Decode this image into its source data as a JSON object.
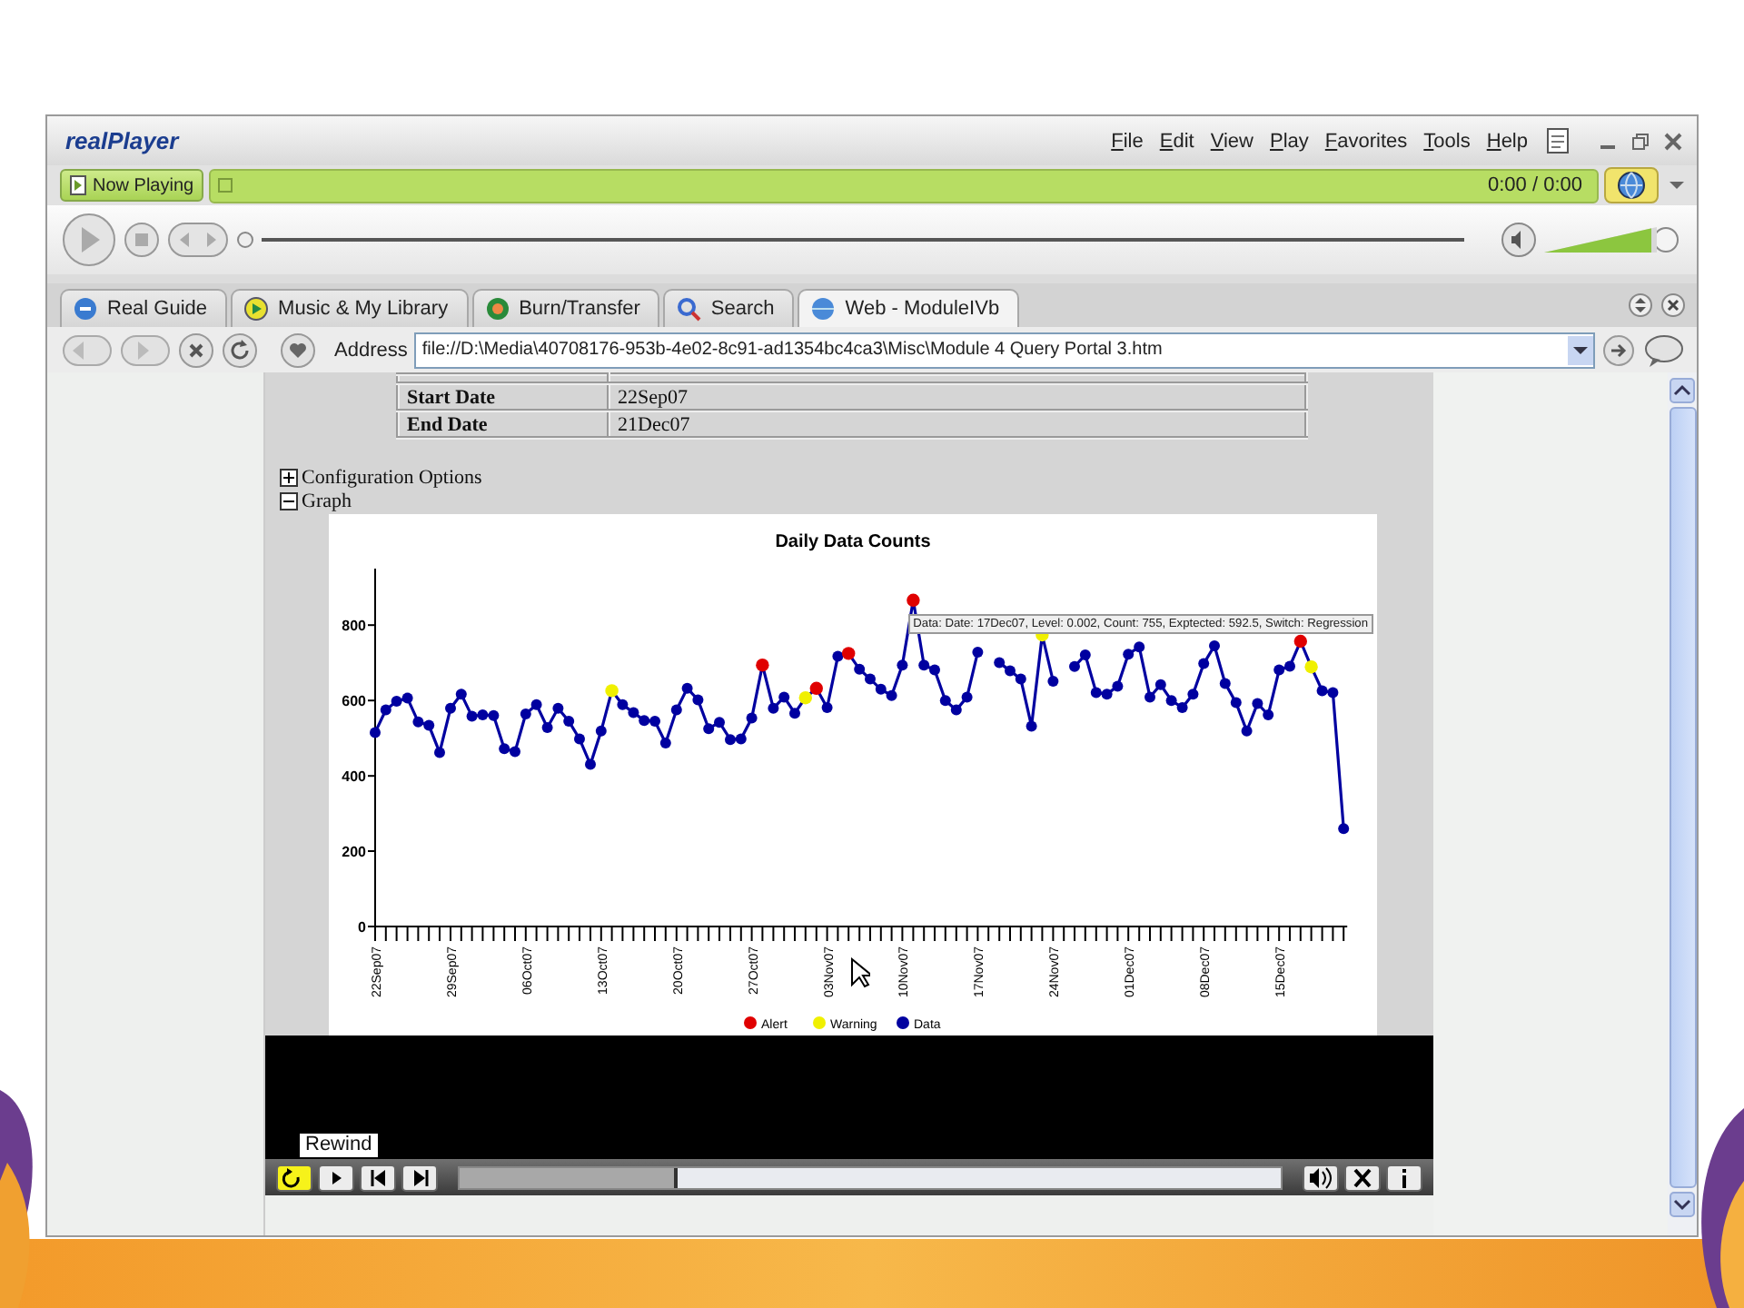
{
  "window": {
    "logo": "realPlayer",
    "menu": [
      "File",
      "Edit",
      "View",
      "Play",
      "Favorites",
      "Tools",
      "Help"
    ]
  },
  "now_playing": {
    "button": "Now Playing",
    "time": "0:00 / 0:00"
  },
  "player": {
    "volume": {
      "level": 0.95
    }
  },
  "tabs": [
    {
      "label": "Real Guide",
      "selected": false
    },
    {
      "label": "Music & My Library",
      "selected": false
    },
    {
      "label": "Burn/Transfer",
      "selected": false
    },
    {
      "label": "Search",
      "selected": false
    },
    {
      "label": "Web - ModuleIVb",
      "selected": true
    }
  ],
  "address_bar": {
    "label": "Address",
    "value": "file://D:\\Media\\40708176-953b-4e02-8c91-ad1354bc4ca3\\Misc\\Module 4 Query Portal 3.htm"
  },
  "page": {
    "table": [
      {
        "label": "Start Date",
        "value": "22Sep07"
      },
      {
        "label": "End Date",
        "value": "21Dec07"
      }
    ],
    "sections": [
      {
        "label": "Configuration Options",
        "expanded": false
      },
      {
        "label": "Graph",
        "expanded": true
      }
    ],
    "graph": {
      "tooltip": "Data: Date: 17Dec07, Level: 0.002, Count: 755, Exptected: 592.5, Switch: Regression",
      "legend": [
        {
          "kind": "alert",
          "label": "Alert",
          "color": "#e00000"
        },
        {
          "kind": "warning",
          "label": "Warning",
          "color": "#f0f000"
        }
      ],
      "alert_flags": [
        false,
        false,
        false,
        false,
        false,
        false,
        false,
        false,
        false,
        false,
        false,
        false,
        false,
        false,
        false,
        false,
        false,
        false,
        false,
        false,
        false,
        false,
        false,
        false,
        false,
        false,
        false,
        false,
        false,
        false,
        false,
        false,
        false,
        false,
        false,
        false,
        true,
        false,
        false,
        false,
        false,
        true,
        false,
        false,
        true,
        false,
        false,
        false,
        false,
        false,
        true,
        false,
        false,
        false,
        false,
        false,
        false,
        false,
        false,
        false,
        false,
        false,
        false,
        false,
        false,
        false,
        false,
        false,
        false,
        false,
        false,
        false,
        false,
        false,
        false,
        false,
        false,
        false,
        false,
        false,
        false,
        false,
        false,
        false,
        false,
        false,
        true,
        false,
        false,
        false,
        false
      ],
      "warning_flags": [
        false,
        false,
        false,
        false,
        false,
        false,
        false,
        false,
        false,
        false,
        false,
        false,
        false,
        false,
        false,
        false,
        false,
        false,
        false,
        false,
        false,
        false,
        true,
        false,
        false,
        false,
        false,
        false,
        false,
        false,
        false,
        false,
        false,
        false,
        false,
        false,
        false,
        false,
        false,
        false,
        true,
        false,
        false,
        false,
        false,
        false,
        false,
        false,
        false,
        false,
        false,
        false,
        false,
        false,
        false,
        false,
        false,
        false,
        false,
        false,
        false,
        false,
        true,
        false,
        false,
        false,
        false,
        false,
        false,
        false,
        false,
        false,
        false,
        false,
        false,
        false,
        false,
        false,
        false,
        false,
        false,
        false,
        false,
        false,
        false,
        false,
        false,
        true,
        false,
        false,
        false
      ],
      "chart_data": {
        "type": "line",
        "title": "Daily Data Counts",
        "categories": [
          "22Sep07",
          null,
          null,
          null,
          null,
          null,
          null,
          "29Sep07",
          null,
          null,
          null,
          null,
          null,
          null,
          "06Oct07",
          null,
          null,
          null,
          null,
          null,
          null,
          "13Oct07",
          null,
          null,
          null,
          null,
          null,
          null,
          "20Oct07",
          null,
          null,
          null,
          null,
          null,
          null,
          "27Oct07",
          null,
          null,
          null,
          null,
          null,
          null,
          "03Nov07",
          null,
          null,
          null,
          null,
          null,
          null,
          "10Nov07",
          null,
          null,
          null,
          null,
          null,
          null,
          "17Nov07",
          null,
          null,
          null,
          null,
          null,
          null,
          "24Nov07",
          null,
          null,
          null,
          null,
          null,
          null,
          "01Dec07",
          null,
          null,
          null,
          null,
          null,
          null,
          "08Dec07",
          null,
          null,
          null,
          null,
          null,
          null,
          "15Dec07",
          null,
          null,
          null,
          null,
          null,
          null
        ],
        "ylim": [
          0,
          950
        ],
        "yticks": [
          0,
          200,
          400,
          600,
          800
        ],
        "series": [
          {
            "name": "Data",
            "color": "#0000a0",
            "marker": "circle",
            "values": [
              515,
              575,
              598,
              606,
              543,
              534,
              462,
              579,
              617,
              558,
              562,
              560,
              472,
              464,
              564,
              589,
              528,
              579,
              545,
              498,
              430,
              519,
              626,
              589,
              568,
              547,
              545,
              487,
              575,
              632,
              602,
              525,
              542,
              496,
              498,
              553,
              694,
              579,
              609,
              566,
              607,
              632,
              581,
              717,
              725,
              683,
              657,
              630,
              613,
              694,
              866,
              694,
              681,
              600,
              575,
              609,
              728,
              null,
              700,
              679,
              657,
              532,
              774,
              651,
              null,
              690,
              721,
              621,
              617,
              638,
              723,
              742,
              609,
              642,
              600,
              581,
              617,
              698,
              745,
              645,
              594,
              519,
              592,
              562,
              681,
              691,
              757,
              689,
              626,
              621,
              260
            ]
          }
        ]
      }
    }
  },
  "video_bar": {
    "tooltip": "Rewind",
    "buttons": [
      {
        "kind": "rewind",
        "selected": true
      },
      {
        "kind": "play",
        "selected": false
      },
      {
        "kind": "previous",
        "selected": false
      },
      {
        "kind": "next",
        "selected": false
      }
    ],
    "progress": {
      "level": 0.26
    },
    "right_buttons": [
      {
        "kind": "volume"
      },
      {
        "kind": "close"
      },
      {
        "kind": "info"
      }
    ]
  }
}
